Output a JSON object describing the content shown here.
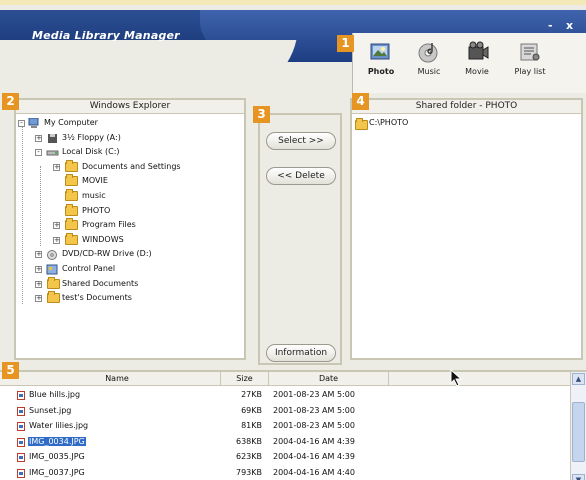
{
  "app": {
    "title": "Media Library Manager",
    "minimize": "-",
    "close": "x"
  },
  "badges": [
    "1",
    "2",
    "3",
    "4",
    "5"
  ],
  "toolbar": {
    "items": [
      {
        "label": "Photo",
        "icon": "photo-icon",
        "active": true
      },
      {
        "label": "Music",
        "icon": "music-icon",
        "active": false
      },
      {
        "label": "Movie",
        "icon": "movie-icon",
        "active": false
      },
      {
        "label": "Play list",
        "icon": "playlist-icon",
        "active": false
      }
    ]
  },
  "explorer": {
    "title": "Windows Explorer",
    "tree": [
      {
        "label": "My Computer",
        "icon": "computer-icon",
        "level": 0,
        "toggle": "-"
      },
      {
        "label": "3½ Floppy (A:)",
        "icon": "floppy-icon",
        "level": 1,
        "toggle": "+"
      },
      {
        "label": "Local Disk (C:)",
        "icon": "disk-icon",
        "level": 1,
        "toggle": "-"
      },
      {
        "label": "Documents and Settings",
        "icon": "folder-icon",
        "level": 2,
        "toggle": "+"
      },
      {
        "label": "MOVIE",
        "icon": "folder-icon",
        "level": 2,
        "toggle": ""
      },
      {
        "label": "music",
        "icon": "folder-icon",
        "level": 2,
        "toggle": ""
      },
      {
        "label": "PHOTO",
        "icon": "folder-icon",
        "level": 2,
        "toggle": ""
      },
      {
        "label": "Program Files",
        "icon": "folder-icon",
        "level": 2,
        "toggle": "+"
      },
      {
        "label": "WINDOWS",
        "icon": "folder-icon",
        "level": 2,
        "toggle": "+"
      },
      {
        "label": "DVD/CD-RW Drive (D:)",
        "icon": "cd-icon",
        "level": 1,
        "toggle": "+"
      },
      {
        "label": "Control Panel",
        "icon": "control-panel-icon",
        "level": 1,
        "toggle": "+"
      },
      {
        "label": "Shared Documents",
        "icon": "folder-icon",
        "level": 1,
        "toggle": "+"
      },
      {
        "label": "test's Documents",
        "icon": "folder-icon",
        "level": 1,
        "toggle": "+"
      }
    ]
  },
  "actions": {
    "select_label": "Select >>",
    "delete_label": "<< Delete",
    "information_label": "Information"
  },
  "shared": {
    "title": "Shared folder - PHOTO",
    "items": [
      {
        "label": "C:\\PHOTO",
        "icon": "folder-icon"
      }
    ]
  },
  "filelist": {
    "columns": [
      "Name",
      "Size",
      "Date"
    ],
    "rows": [
      {
        "name": "Blue hills.jpg",
        "size": "27KB",
        "date": "2001-08-23 AM 5:00",
        "selected": false
      },
      {
        "name": "Sunset.jpg",
        "size": "69KB",
        "date": "2001-08-23 AM 5:00",
        "selected": false
      },
      {
        "name": "Water lilies.jpg",
        "size": "81KB",
        "date": "2001-08-23 AM 5:00",
        "selected": false
      },
      {
        "name": "IMG_0034.JPG",
        "size": "638KB",
        "date": "2004-04-16 AM 4:39",
        "selected": true
      },
      {
        "name": "IMG_0035.JPG",
        "size": "623KB",
        "date": "2004-04-16 AM 4:39",
        "selected": false
      },
      {
        "name": "IMG_0037.JPG",
        "size": "793KB",
        "date": "2004-04-16 AM 4:40",
        "selected": false
      }
    ]
  },
  "colors": {
    "titlebar": "#1f3f80",
    "badge": "#e69523",
    "selection": "#2f6bc7",
    "folder": "#f3c64b"
  }
}
